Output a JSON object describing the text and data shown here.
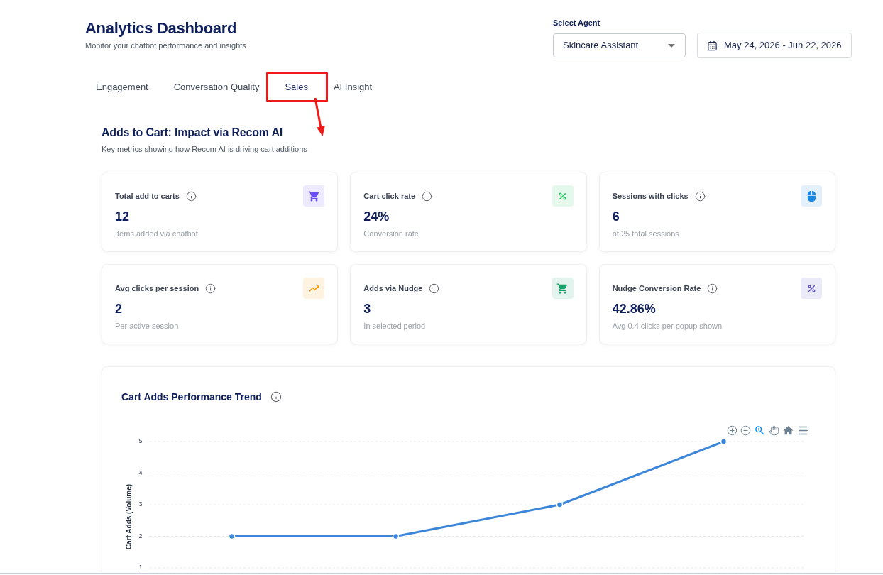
{
  "header": {
    "title": "Analytics Dashboard",
    "subtitle": "Monitor your chatbot performance and insights"
  },
  "agent_select": {
    "label": "Select Agent",
    "value": "Skincare Assistant"
  },
  "date_range": {
    "value": "May 24, 2026 - Jun 22, 2026"
  },
  "tabs": [
    {
      "label": "Engagement",
      "selected": false,
      "highlighted": false
    },
    {
      "label": "Conversation Quality",
      "selected": false,
      "highlighted": false
    },
    {
      "label": "Sales",
      "selected": true,
      "highlighted": true
    },
    {
      "label": "AI Insight",
      "selected": false,
      "highlighted": false
    }
  ],
  "section": {
    "title": "Adds to Cart: Impact via Recom AI",
    "subtitle": "Key metrics showing how Recom AI is driving cart additions"
  },
  "metrics": [
    {
      "label": "Total add to carts",
      "value": "12",
      "caption": "Items added via chatbot",
      "color": "#6a4df4"
    },
    {
      "label": "Cart click rate",
      "value": "24%",
      "caption": "Conversion rate",
      "color": "#22c55e"
    },
    {
      "label": "Sessions with clicks",
      "value": "6",
      "caption": "of 25 total sessions",
      "color": "#1e88e5"
    },
    {
      "label": "Avg clicks per session",
      "value": "2",
      "caption": "Per active session",
      "color": "#f59e0b"
    },
    {
      "label": "Adds via Nudge",
      "value": "3",
      "caption": "In selected period",
      "color": "#16a06a"
    },
    {
      "label": "Nudge Conversion Rate",
      "value": "42.86%",
      "caption": "Avg 0.4 clicks per popup shown",
      "color": "#5b4fc7"
    }
  ],
  "trend_card": {
    "title": "Cart Adds Performance Trend",
    "toolbar": [
      {
        "selected": false
      },
      {
        "selected": false
      },
      {
        "selected": true
      },
      {
        "selected": false
      },
      {
        "selected": false
      },
      {
        "selected": false
      }
    ],
    "chart_data": {
      "type": "line",
      "ylabel": "Cart Adds (Volume)",
      "categories": [
        null,
        null,
        null,
        null
      ],
      "ylim": [
        1,
        5
      ],
      "yticks": [
        {
          "value": 1,
          "label": "1"
        },
        {
          "value": 2,
          "label": "2"
        },
        {
          "value": 3,
          "label": "3"
        },
        {
          "value": 4,
          "label": "4"
        },
        {
          "value": 5,
          "label": "5"
        }
      ],
      "grid": true,
      "series": [
        {
          "color": "#3b86d9",
          "marker": "circle",
          "values": [
            2,
            2,
            3,
            5
          ]
        }
      ]
    }
  }
}
